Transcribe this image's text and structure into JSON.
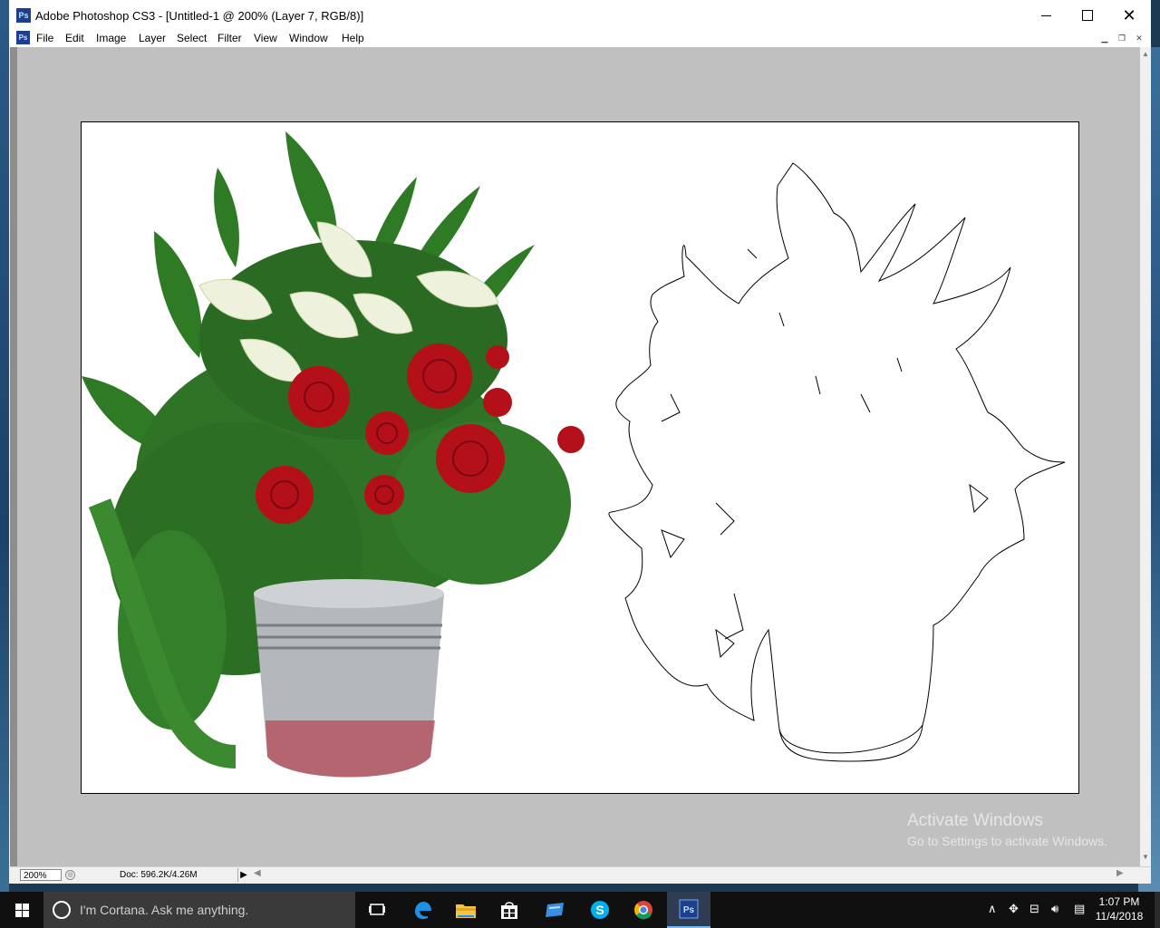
{
  "window": {
    "title": "Adobe Photoshop CS3 - [Untitled-1 @ 200% (Layer 7, RGB/8)]",
    "app_icon": "Ps"
  },
  "menu": {
    "items": [
      "File",
      "Edit",
      "Image",
      "Layer",
      "Select",
      "Filter",
      "View",
      "Window",
      "Help"
    ]
  },
  "document": {
    "left_image": "bouquet of red roses and white calla lilies with ivy in a metal pail",
    "right_image": "outline trace of the same bouquet"
  },
  "status": {
    "zoom": "200%",
    "doc_info": "Doc: 596.2K/4.26M"
  },
  "watermark": {
    "line1": "Activate Windows",
    "line2": "Go to Settings to activate Windows."
  },
  "taskbar": {
    "search_placeholder": "I'm Cortana. Ask me anything.",
    "apps": [
      "task-view-icon",
      "edge-icon",
      "file-explorer-icon",
      "store-icon",
      "remote-desktop-icon",
      "skype-icon",
      "chrome-icon",
      "photoshop-icon"
    ],
    "active_app_label": "Ps",
    "skype_label": "S",
    "time": "1:07 PM",
    "date": "11/4/2018"
  },
  "colors": {
    "canvas_bg": "#c0c0c0",
    "taskbar_bg": "#101010",
    "rose_red": "#b3101a",
    "leaf_green": "#2f7a25"
  }
}
